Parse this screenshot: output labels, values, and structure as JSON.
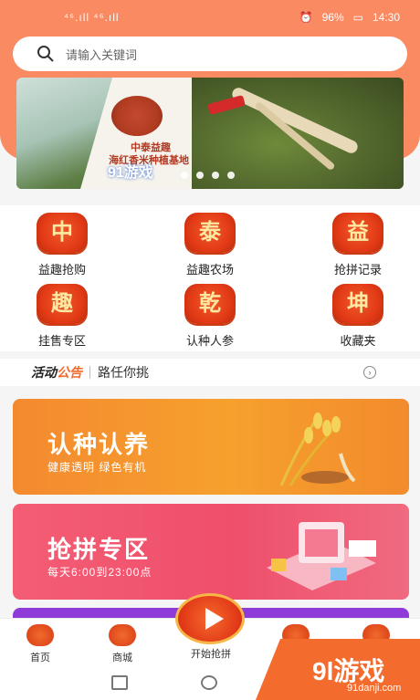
{
  "status_bar": {
    "signal_text": "⁴⁶.ıll ⁴⁶.ıll",
    "battery": "96%",
    "time": "14:30"
  },
  "search": {
    "placeholder": "请输入关键词"
  },
  "banner": {
    "text_line1": "中泰益趣",
    "text_line2": "海红香米种植基地",
    "watermark": "91游戏",
    "watermark_url": "91danji.com"
  },
  "grid": {
    "items": [
      {
        "glyph": "中",
        "label": "益趣抢购"
      },
      {
        "glyph": "泰",
        "label": "益趣农场"
      },
      {
        "glyph": "益",
        "label": "抢拼记录"
      },
      {
        "glyph": "趣",
        "label": "挂售专区"
      },
      {
        "glyph": "乾",
        "label": "认种人参"
      },
      {
        "glyph": "坤",
        "label": "收藏夹"
      }
    ]
  },
  "notice": {
    "tag_part1": "活动",
    "tag_part2": "公告",
    "text": "路任你挑"
  },
  "cards": [
    {
      "title": "认种认养",
      "subtitle": "健康透明 绿色有机"
    },
    {
      "title": "抢拼专区",
      "subtitle": "每天6:00到23:00点"
    }
  ],
  "tabbar": {
    "items": [
      {
        "label": "首页"
      },
      {
        "label": "商城"
      },
      {
        "label": "开始抢拼"
      },
      {
        "label": ""
      },
      {
        "label": ""
      }
    ]
  },
  "watermark": {
    "brand": "9l游戏",
    "site": "91danji.com"
  },
  "colors": {
    "accent": "#f98a62",
    "card1": "#f6a02e",
    "card2": "#ef4f6b",
    "card3": "#8e3bd9"
  }
}
